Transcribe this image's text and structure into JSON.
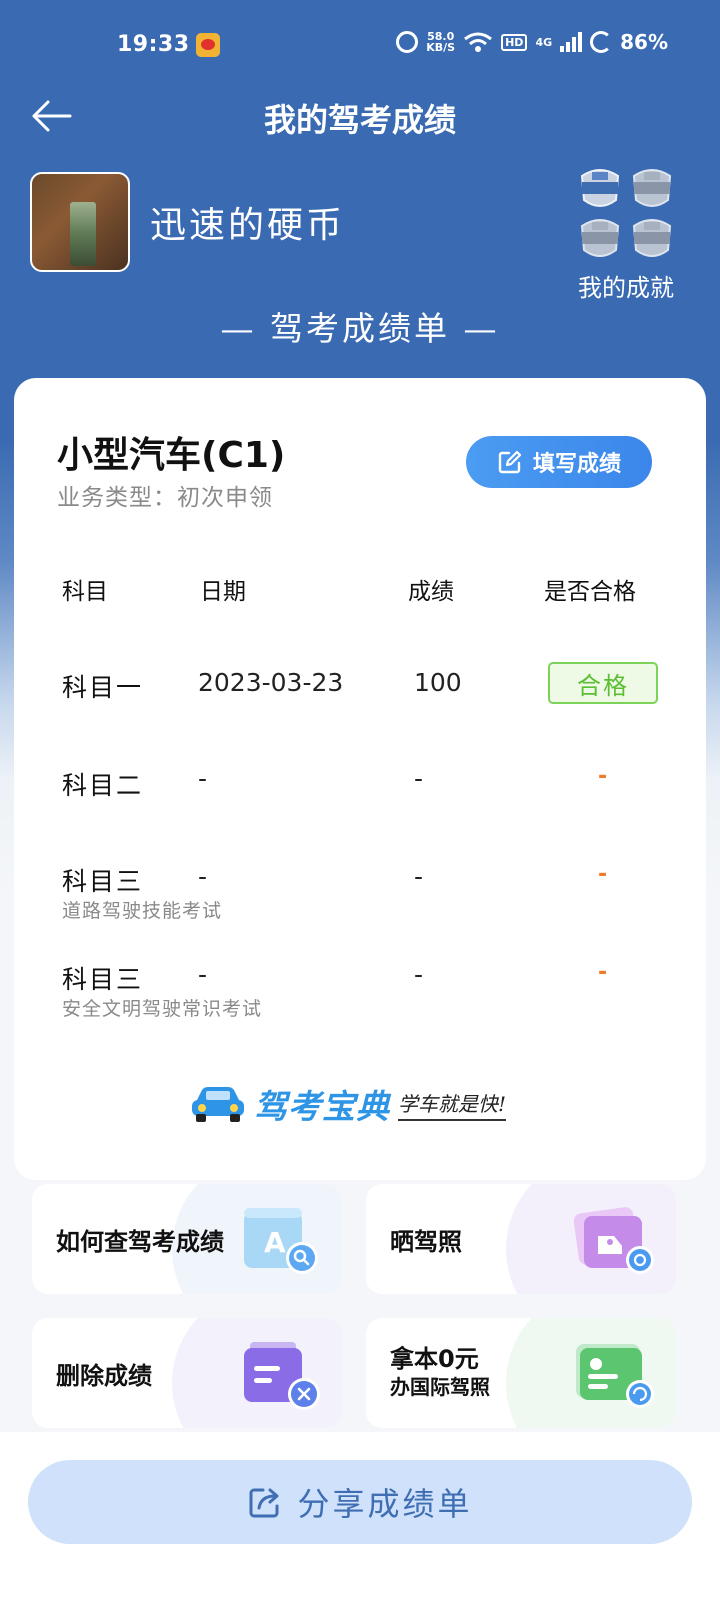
{
  "status_bar": {
    "time": "19:33",
    "net_speed_value": "58.0",
    "net_speed_unit": "KB/S",
    "hd_label": "HD",
    "network_label": "4G",
    "battery": "86%"
  },
  "header": {
    "title": "我的驾考成绩"
  },
  "profile": {
    "username": "迅速的硬币",
    "achievements_label": "我的成就",
    "badges": [
      "exam-pass-badge-1",
      "exam-pass-badge-2",
      "exam-pass-badge-3",
      "exam-pass-badge-4"
    ]
  },
  "report": {
    "heading": "— 驾考成绩单 —",
    "license_type": "小型汽车(C1)",
    "business_type": "业务类型：初次申领",
    "fill_button": "填写成绩",
    "columns": {
      "subject": "科目",
      "date": "日期",
      "score": "成绩",
      "passed": "是否合格"
    },
    "rows": [
      {
        "subject": "科目一",
        "subtitle": "",
        "date": "2023-03-23",
        "score": "100",
        "passed": "合格"
      },
      {
        "subject": "科目二",
        "subtitle": "",
        "date": "-",
        "score": "-",
        "passed": "-"
      },
      {
        "subject": "科目三",
        "subtitle": "道路驾驶技能考试",
        "date": "-",
        "score": "-",
        "passed": "-"
      },
      {
        "subject": "科目三",
        "subtitle": "安全文明驾驶常识考试",
        "date": "-",
        "score": "-",
        "passed": "-"
      }
    ],
    "brand_name": "驾考宝典",
    "brand_slogan": "学车就是快!"
  },
  "tiles": [
    {
      "label": "如何查驾考成绩",
      "icon": "search-document-icon"
    },
    {
      "label": "晒驾照",
      "icon": "photo-share-icon"
    },
    {
      "label": "删除成绩",
      "icon": "delete-record-icon"
    },
    {
      "label_line1": "拿本0元",
      "label_line2": "办国际驾照",
      "icon": "international-license-icon"
    }
  ],
  "share": {
    "label": "分享成绩单"
  },
  "colors": {
    "header_blue": "#3a6bb2",
    "pass_green": "#5bbf33",
    "pending_orange": "#f07a2a",
    "button_blue": "#3b86ea",
    "share_bg": "#cfe1fb"
  }
}
